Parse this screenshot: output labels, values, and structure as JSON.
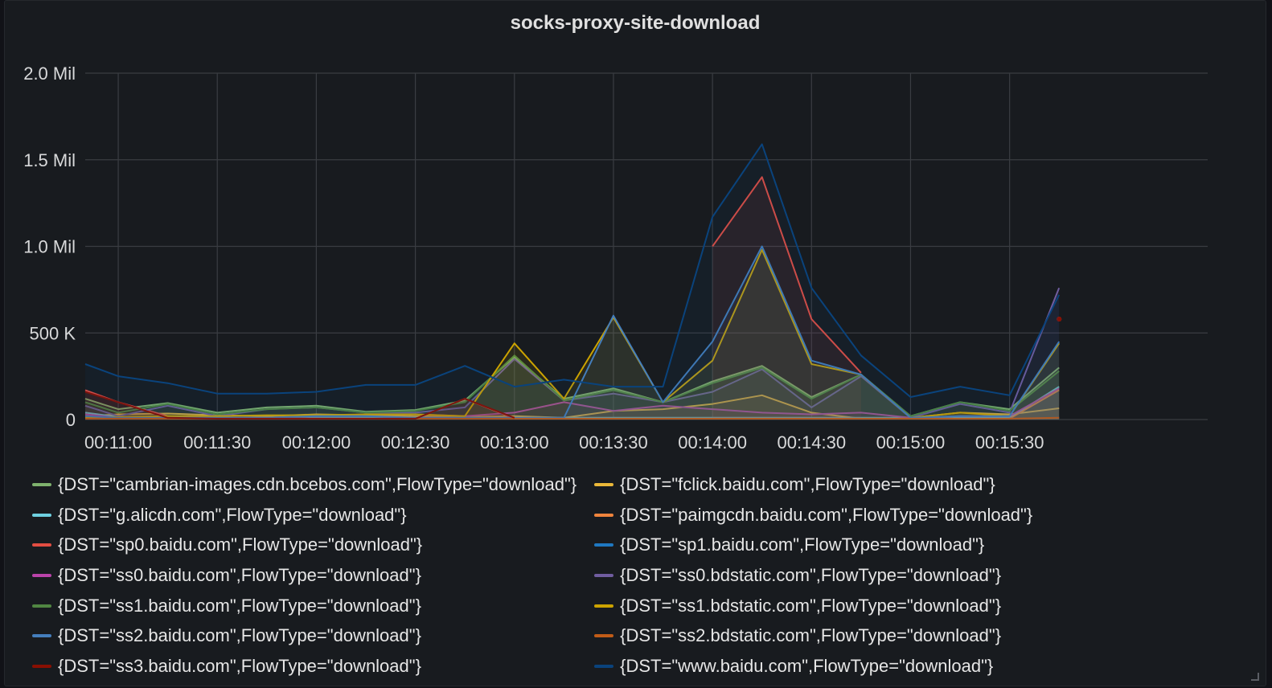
{
  "panel": {
    "title": "socks-proxy-site-download"
  },
  "chart_data": {
    "type": "line",
    "title": "socks-proxy-site-download",
    "ylim": [
      0,
      2000000
    ],
    "y_ticks": [
      {
        "value": 0,
        "label": "0"
      },
      {
        "value": 500000,
        "label": "500 K"
      },
      {
        "value": 1000000,
        "label": "1.0 Mil"
      },
      {
        "value": 1500000,
        "label": "1.5 Mil"
      },
      {
        "value": 2000000,
        "label": "2.0 Mil"
      }
    ],
    "x_ticks": [
      "00:11:00",
      "00:11:30",
      "00:12:00",
      "00:12:30",
      "00:13:00",
      "00:13:30",
      "00:14:00",
      "00:14:30",
      "00:15:00",
      "00:15:30"
    ],
    "x_range_seconds_after_first_tick": [
      -10,
      330
    ],
    "x": [
      -10,
      0,
      15,
      30,
      45,
      60,
      75,
      90,
      105,
      120,
      135,
      150,
      165,
      180,
      195,
      210,
      225,
      240,
      255,
      270,
      285,
      300,
      315,
      330
    ],
    "grid": true,
    "legend_position": "bottom",
    "series": [
      {
        "name": "{DST=\"cambrian-images.cdn.bcebos.com\",FlowType=\"download\"}",
        "color": "#7eb26d",
        "values": [
          120000,
          60000,
          95000,
          40000,
          70000,
          80000,
          45000,
          55000,
          110000,
          360000,
          120000,
          180000,
          100000,
          220000,
          310000,
          130000,
          260000,
          20000,
          100000,
          60000,
          300000,
          null,
          null,
          null
        ]
      },
      {
        "name": "{DST=\"fclick.baidu.com\",FlowType=\"download\"}",
        "color": "#eab839",
        "values": [
          20000,
          30000,
          35000,
          25000,
          20000,
          30000,
          25000,
          20000,
          15000,
          20000,
          10000,
          50000,
          60000,
          90000,
          140000,
          40000,
          5000,
          10000,
          40000,
          30000,
          65000,
          null,
          null,
          null
        ]
      },
      {
        "name": "{DST=\"g.alicdn.com\",FlowType=\"download\"}",
        "color": "#6ed0e0",
        "values": [
          40000,
          15000,
          10000,
          10000,
          10000,
          10000,
          10000,
          10000,
          10000,
          10000,
          10000,
          10000,
          10000,
          10000,
          10000,
          10000,
          10000,
          10000,
          10000,
          10000,
          190000,
          null,
          null,
          null
        ]
      },
      {
        "name": "{DST=\"paimgcdn.baidu.com\",FlowType=\"download\"}",
        "color": "#ef843c",
        "values": [
          10000,
          10000,
          5000,
          5000,
          5000,
          5000,
          5000,
          5000,
          5000,
          5000,
          5000,
          5000,
          5000,
          5000,
          5000,
          5000,
          5000,
          5000,
          5000,
          5000,
          170000,
          null,
          null,
          null
        ]
      },
      {
        "name": "{DST=\"sp0.baidu.com\",FlowType=\"download\"}",
        "color": "#e24d42",
        "values": [
          170000,
          100000,
          20000,
          5000,
          5000,
          5000,
          5000,
          5000,
          120000,
          5000,
          null,
          null,
          null,
          1000000,
          1400000,
          580000,
          270000,
          null,
          null,
          null,
          580000,
          null,
          null,
          null
        ]
      },
      {
        "name": "{DST=\"sp1.baidu.com\",FlowType=\"download\"}",
        "color": "#1f78c1",
        "values": [
          5000,
          5000,
          5000,
          5000,
          5000,
          5000,
          5000,
          5000,
          5000,
          5000,
          5000,
          5000,
          5000,
          5000,
          5000,
          5000,
          5000,
          5000,
          5000,
          5000,
          10000,
          null,
          null,
          null
        ]
      },
      {
        "name": "{DST=\"ss0.baidu.com\",FlowType=\"download\"}",
        "color": "#ba43a9",
        "values": [
          30000,
          10000,
          10000,
          10000,
          10000,
          20000,
          30000,
          30000,
          20000,
          40000,
          100000,
          50000,
          80000,
          60000,
          40000,
          30000,
          40000,
          10000,
          20000,
          20000,
          180000,
          null,
          null,
          null
        ]
      },
      {
        "name": "{DST=\"ss0.bdstatic.com\",FlowType=\"download\"}",
        "color": "#705da0",
        "values": [
          80000,
          20000,
          80000,
          20000,
          60000,
          70000,
          40000,
          40000,
          70000,
          350000,
          110000,
          150000,
          100000,
          160000,
          290000,
          70000,
          250000,
          10000,
          90000,
          40000,
          760000,
          null,
          null,
          null
        ]
      },
      {
        "name": "{DST=\"ss1.baidu.com\",FlowType=\"download\"}",
        "color": "#508642",
        "values": [
          100000,
          40000,
          90000,
          30000,
          60000,
          70000,
          40000,
          50000,
          100000,
          370000,
          110000,
          170000,
          100000,
          210000,
          300000,
          120000,
          260000,
          20000,
          100000,
          50000,
          280000,
          null,
          null,
          null
        ]
      },
      {
        "name": "{DST=\"ss1.bdstatic.com\",FlowType=\"download\"}",
        "color": "#cca300",
        "values": [
          10000,
          15000,
          20000,
          20000,
          25000,
          25000,
          30000,
          30000,
          20000,
          440000,
          120000,
          590000,
          100000,
          340000,
          980000,
          320000,
          260000,
          10000,
          40000,
          20000,
          440000,
          null,
          null,
          null
        ]
      },
      {
        "name": "{DST=\"ss2.baidu.com\",FlowType=\"download\"}",
        "color": "#447ebc",
        "values": [
          20000,
          10000,
          10000,
          10000,
          10000,
          20000,
          20000,
          10000,
          10000,
          10000,
          10000,
          600000,
          100000,
          450000,
          1000000,
          340000,
          260000,
          10000,
          20000,
          20000,
          450000,
          null,
          null,
          null
        ]
      },
      {
        "name": "{DST=\"ss2.bdstatic.com\",FlowType=\"download\"}",
        "color": "#c15c17",
        "values": [
          5000,
          5000,
          5000,
          5000,
          5000,
          5000,
          5000,
          5000,
          5000,
          5000,
          5000,
          5000,
          5000,
          5000,
          5000,
          5000,
          5000,
          5000,
          5000,
          5000,
          10000,
          null,
          null,
          null
        ]
      },
      {
        "name": "{DST=\"ss3.baidu.com\",FlowType=\"download\"}",
        "color": "#890f02",
        "values": [
          160000,
          100000,
          10000,
          5000,
          5000,
          5000,
          5000,
          5000,
          120000,
          10000,
          null,
          null,
          null,
          null,
          null,
          null,
          null,
          null,
          null,
          null,
          580000,
          null,
          null,
          null
        ]
      },
      {
        "name": "{DST=\"www.baidu.com\",FlowType=\"download\"}",
        "color": "#0a437c",
        "values": [
          320000,
          250000,
          210000,
          150000,
          150000,
          160000,
          200000,
          200000,
          310000,
          190000,
          230000,
          190000,
          190000,
          1170000,
          1590000,
          760000,
          370000,
          130000,
          190000,
          140000,
          720000,
          null,
          null,
          null
        ]
      }
    ]
  }
}
